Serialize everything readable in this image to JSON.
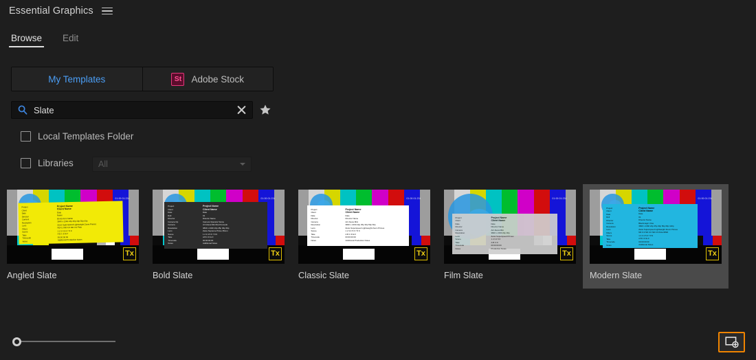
{
  "window": {
    "title": "Essential Graphics",
    "menu_icon": "hamburger-menu-icon"
  },
  "tabs": [
    {
      "label": "Browse",
      "active": true
    },
    {
      "label": "Edit",
      "active": false
    }
  ],
  "source_toggle": [
    {
      "label": "My Templates",
      "active": true
    },
    {
      "label": "Adobe Stock",
      "active": false,
      "badge": "St"
    }
  ],
  "search": {
    "value": "Slate",
    "placeholder": "Search",
    "icon": "search-icon",
    "clear_icon": "clear-x-icon",
    "favorite_icon": "star-icon"
  },
  "filters": {
    "local_templates": {
      "label": "Local Templates Folder",
      "checked": false
    },
    "libraries": {
      "label": "Libraries",
      "checked": false
    },
    "library_select": {
      "value": "All"
    }
  },
  "templates": [
    {
      "name": "Angled Slate",
      "selected": false,
      "card_style": "yellow",
      "card_bg": "#f2ea06",
      "card_text": "#111111",
      "title": "Project Name",
      "subtitle": "Client Name",
      "fields": [
        {
          "label": "Project",
          "value": "Project Name"
        },
        {
          "label": "Client",
          "value": "Client Name"
        },
        {
          "label": "Date",
          "value": "Date"
        },
        {
          "label": "Director",
          "value": "Name"
        },
        {
          "label": "Camera",
          "value": "Bl Ack M Ic Name"
        },
        {
          "label": "Resolution",
          "value": "3840 x 2160 24p 25p 30p 50p 60p"
        },
        {
          "label": "Lens",
          "value": "Zeiss Superspeed Lightweight Zoom Primes"
        },
        {
          "label": "Filters",
          "value": "ND 0.3 ND 0.6 ND 0.9 Pola"
        },
        {
          "label": "Scene",
          "value": "1 2 3 4 5 6 7 8 9"
        },
        {
          "label": "Take",
          "value": "A B C D E F"
        },
        {
          "label": "Timecode",
          "value": "00:00:00:00"
        },
        {
          "label": "Notes",
          "value": "Additional Production Notes"
        }
      ]
    },
    {
      "name": "Bold Slate",
      "selected": false,
      "card_style": "dark",
      "card_bg": "#2c2c2c",
      "card_text": "#e6e6e6",
      "title": "Project Name",
      "subtitle": "Client Name",
      "fields": [
        {
          "label": "Project",
          "value": "Project Name"
        },
        {
          "label": "Client",
          "value": "Client Name"
        },
        {
          "label": "Date",
          "value": "Date"
        },
        {
          "label": "Roll",
          "value": "01"
        },
        {
          "label": "Director",
          "value": "Director Name"
        },
        {
          "label": "Camera Op",
          "value": "Camera Operator Name"
        },
        {
          "label": "Camera",
          "value": "Arri Alexa Mini Red Komodo"
        },
        {
          "label": "Resolution",
          "value": "3840 x 2160 24p 25p 30p 60p"
        },
        {
          "label": "Lens",
          "value": "Zeiss Supreme Prime 35mm"
        },
        {
          "label": "Scene",
          "value": "1 2 3 4 5 6 7 8 9"
        },
        {
          "label": "Take",
          "value": "A B C D E F"
        },
        {
          "label": "Timecode",
          "value": "00:00:00:00"
        },
        {
          "label": "Notes",
          "value": "Additional Notes"
        }
      ]
    },
    {
      "name": "Classic Slate",
      "selected": false,
      "card_style": "white",
      "card_bg": "#ffffff",
      "card_text": "#101010",
      "title": "Project Name",
      "subtitle": "Client Name",
      "fields": [
        {
          "label": "Project",
          "value": "Project Name"
        },
        {
          "label": "Client",
          "value": "Client Name"
        },
        {
          "label": "Date",
          "value": "Date"
        },
        {
          "label": "Director",
          "value": "Director Name"
        },
        {
          "label": "Camera",
          "value": "Arri Alexa Mini"
        },
        {
          "label": "Resolution",
          "value": "3840 x 2160 24p 25p 30p 50p 60p"
        },
        {
          "label": "Lens",
          "value": "Zeiss Superspeed Lightweight Zoom Primes"
        },
        {
          "label": "Scene",
          "value": "1 2 3 4 5 6 7 8 9"
        },
        {
          "label": "Take",
          "value": "A B C D E F"
        },
        {
          "label": "Timecode",
          "value": "00:00:00:00"
        },
        {
          "label": "Notes",
          "value": "Additional Production Notes"
        }
      ]
    },
    {
      "name": "Film Slate",
      "selected": false,
      "card_style": "gray",
      "card_bg": "#cfcfcf",
      "card_text": "#1a1a1a",
      "title": "Project Name",
      "subtitle": "Client Name",
      "fields": [
        {
          "label": "Project",
          "value": "Project Name"
        },
        {
          "label": "Client",
          "value": "Client Name"
        },
        {
          "label": "Date",
          "value": "Date"
        },
        {
          "label": "Director",
          "value": "Director Name"
        },
        {
          "label": "Camera",
          "value": "Arri Alexa Mini"
        },
        {
          "label": "Resolution",
          "value": "3840 x 2160 24p 30p"
        },
        {
          "label": "Lens",
          "value": "Zeiss Superspeed Primes"
        },
        {
          "label": "Scene",
          "value": "1 2 3 4 5 6"
        },
        {
          "label": "Take",
          "value": "A B C D"
        },
        {
          "label": "Timecode",
          "value": "00:00:00:00"
        },
        {
          "label": "Notes",
          "value": "Production Notes"
        }
      ]
    },
    {
      "name": "Modern Slate",
      "selected": true,
      "card_style": "cyan",
      "card_bg": "#22b6e0",
      "card_text": "#0d0d0d",
      "title": "Project Name",
      "subtitle": "Client Name",
      "fields": [
        {
          "label": "Project",
          "value": "Project Name"
        },
        {
          "label": "Client",
          "value": "Client Name"
        },
        {
          "label": "Date",
          "value": "Date"
        },
        {
          "label": "Roll",
          "value": "01"
        },
        {
          "label": "Director",
          "value": "Director Name"
        },
        {
          "label": "Camera",
          "value": "Blackmagic Ursa"
        },
        {
          "label": "Resolution",
          "value": "3840 x 2160 24p 25p 30p 50p 60p 120p"
        },
        {
          "label": "Lens",
          "value": "Zeiss Superspeed Lightweight Zoom Primes"
        },
        {
          "label": "Filters",
          "value": "ND 0.3 ND 0.6 ND 0.9 Pola IRND"
        },
        {
          "label": "Scene",
          "value": "1 2 3 4 5 6 7 8 9"
        },
        {
          "label": "Take",
          "value": "A B C D E F"
        },
        {
          "label": "Timecode",
          "value": "00:00:00:00"
        },
        {
          "label": "Notes",
          "value": "Additional Notes"
        }
      ]
    }
  ],
  "thumbnail": {
    "timecode": "01:00:01:234",
    "tx_badge": "Tx",
    "color_bars": [
      "#9d9d9d",
      "#d6d6d6",
      "#d6d600",
      "#00c2c2",
      "#00bd2e",
      "#d000c8",
      "#d20d0d",
      "#1414d8",
      "#9d9d9d"
    ],
    "lower_bars": [
      "#0b0b0b",
      "#00c8cf",
      "#e9e900",
      "#0b0b0b",
      "#b4b4b4",
      "#ffffff",
      "#0b0b0b",
      "#1414d8",
      "#d20d0d"
    ]
  },
  "footer": {
    "zoom_slider": {
      "value": 0,
      "min": 0,
      "max": 100
    },
    "new_item_button": {
      "icon": "new-graphic-icon",
      "accent": "#f08400"
    }
  }
}
